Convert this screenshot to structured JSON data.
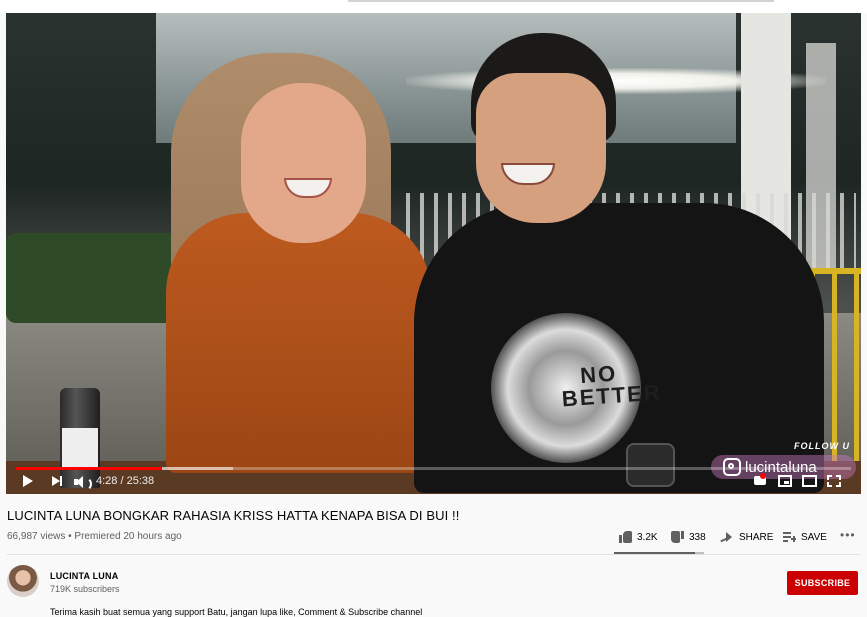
{
  "video": {
    "overlay": {
      "follow_text": "FOLLOW U",
      "instagram_handle": "lucintaluna"
    },
    "shirt_print": [
      "NO",
      "BETTER"
    ],
    "controls": {
      "time": "4:28 / 25:38",
      "progress_fraction": 0.175,
      "buffer_fraction": 0.26,
      "accent_color": "#ff0000"
    }
  },
  "info": {
    "title": "LUCINTA LUNA BONGKAR RAHASIA KRISS HATTA KENAPA BISA DI BUI !!",
    "meta": "66,987 views • Premiered 20 hours ago",
    "actions": {
      "like_count": "3.2K",
      "dislike_count": "338",
      "share_label": "SHARE",
      "save_label": "SAVE",
      "like_fraction": 0.905
    }
  },
  "channel": {
    "name": "LUCINTA LUNA",
    "subscribers": "719K subscribers",
    "subscribe_label": "SUBSCRIBE",
    "subscribe_color": "#cc0000"
  },
  "description": {
    "text": "Terima kasih buat semua yang support Batu, jangan lupa like, Comment & Subscribe channel"
  },
  "icons": [
    "play-icon",
    "next-icon",
    "volume-icon",
    "cc-icon",
    "miniplayer-icon",
    "theater-icon",
    "fullscreen-icon",
    "thumb-up-icon",
    "thumb-down-icon",
    "share-icon",
    "save-icon",
    "more-icon",
    "instagram-icon"
  ]
}
